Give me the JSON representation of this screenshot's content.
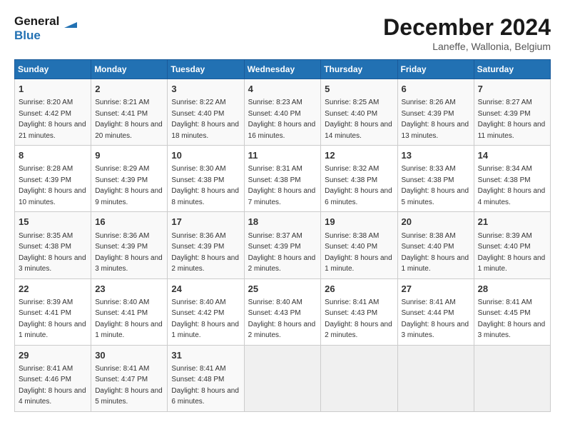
{
  "header": {
    "logo_line1": "General",
    "logo_line2": "Blue",
    "month_title": "December 2024",
    "location": "Laneffe, Wallonia, Belgium"
  },
  "days_of_week": [
    "Sunday",
    "Monday",
    "Tuesday",
    "Wednesday",
    "Thursday",
    "Friday",
    "Saturday"
  ],
  "weeks": [
    [
      {
        "day": "1",
        "sunrise": "8:20 AM",
        "sunset": "4:42 PM",
        "daylight": "8 hours and 21 minutes."
      },
      {
        "day": "2",
        "sunrise": "8:21 AM",
        "sunset": "4:41 PM",
        "daylight": "8 hours and 20 minutes."
      },
      {
        "day": "3",
        "sunrise": "8:22 AM",
        "sunset": "4:40 PM",
        "daylight": "8 hours and 18 minutes."
      },
      {
        "day": "4",
        "sunrise": "8:23 AM",
        "sunset": "4:40 PM",
        "daylight": "8 hours and 16 minutes."
      },
      {
        "day": "5",
        "sunrise": "8:25 AM",
        "sunset": "4:40 PM",
        "daylight": "8 hours and 14 minutes."
      },
      {
        "day": "6",
        "sunrise": "8:26 AM",
        "sunset": "4:39 PM",
        "daylight": "8 hours and 13 minutes."
      },
      {
        "day": "7",
        "sunrise": "8:27 AM",
        "sunset": "4:39 PM",
        "daylight": "8 hours and 11 minutes."
      }
    ],
    [
      {
        "day": "8",
        "sunrise": "8:28 AM",
        "sunset": "4:39 PM",
        "daylight": "8 hours and 10 minutes."
      },
      {
        "day": "9",
        "sunrise": "8:29 AM",
        "sunset": "4:39 PM",
        "daylight": "8 hours and 9 minutes."
      },
      {
        "day": "10",
        "sunrise": "8:30 AM",
        "sunset": "4:38 PM",
        "daylight": "8 hours and 8 minutes."
      },
      {
        "day": "11",
        "sunrise": "8:31 AM",
        "sunset": "4:38 PM",
        "daylight": "8 hours and 7 minutes."
      },
      {
        "day": "12",
        "sunrise": "8:32 AM",
        "sunset": "4:38 PM",
        "daylight": "8 hours and 6 minutes."
      },
      {
        "day": "13",
        "sunrise": "8:33 AM",
        "sunset": "4:38 PM",
        "daylight": "8 hours and 5 minutes."
      },
      {
        "day": "14",
        "sunrise": "8:34 AM",
        "sunset": "4:38 PM",
        "daylight": "8 hours and 4 minutes."
      }
    ],
    [
      {
        "day": "15",
        "sunrise": "8:35 AM",
        "sunset": "4:38 PM",
        "daylight": "8 hours and 3 minutes."
      },
      {
        "day": "16",
        "sunrise": "8:36 AM",
        "sunset": "4:39 PM",
        "daylight": "8 hours and 3 minutes."
      },
      {
        "day": "17",
        "sunrise": "8:36 AM",
        "sunset": "4:39 PM",
        "daylight": "8 hours and 2 minutes."
      },
      {
        "day": "18",
        "sunrise": "8:37 AM",
        "sunset": "4:39 PM",
        "daylight": "8 hours and 2 minutes."
      },
      {
        "day": "19",
        "sunrise": "8:38 AM",
        "sunset": "4:40 PM",
        "daylight": "8 hours and 1 minute."
      },
      {
        "day": "20",
        "sunrise": "8:38 AM",
        "sunset": "4:40 PM",
        "daylight": "8 hours and 1 minute."
      },
      {
        "day": "21",
        "sunrise": "8:39 AM",
        "sunset": "4:40 PM",
        "daylight": "8 hours and 1 minute."
      }
    ],
    [
      {
        "day": "22",
        "sunrise": "8:39 AM",
        "sunset": "4:41 PM",
        "daylight": "8 hours and 1 minute."
      },
      {
        "day": "23",
        "sunrise": "8:40 AM",
        "sunset": "4:41 PM",
        "daylight": "8 hours and 1 minute."
      },
      {
        "day": "24",
        "sunrise": "8:40 AM",
        "sunset": "4:42 PM",
        "daylight": "8 hours and 1 minute."
      },
      {
        "day": "25",
        "sunrise": "8:40 AM",
        "sunset": "4:43 PM",
        "daylight": "8 hours and 2 minutes."
      },
      {
        "day": "26",
        "sunrise": "8:41 AM",
        "sunset": "4:43 PM",
        "daylight": "8 hours and 2 minutes."
      },
      {
        "day": "27",
        "sunrise": "8:41 AM",
        "sunset": "4:44 PM",
        "daylight": "8 hours and 3 minutes."
      },
      {
        "day": "28",
        "sunrise": "8:41 AM",
        "sunset": "4:45 PM",
        "daylight": "8 hours and 3 minutes."
      }
    ],
    [
      {
        "day": "29",
        "sunrise": "8:41 AM",
        "sunset": "4:46 PM",
        "daylight": "8 hours and 4 minutes."
      },
      {
        "day": "30",
        "sunrise": "8:41 AM",
        "sunset": "4:47 PM",
        "daylight": "8 hours and 5 minutes."
      },
      {
        "day": "31",
        "sunrise": "8:41 AM",
        "sunset": "4:48 PM",
        "daylight": "8 hours and 6 minutes."
      },
      null,
      null,
      null,
      null
    ]
  ],
  "labels": {
    "sunrise": "Sunrise:",
    "sunset": "Sunset:",
    "daylight": "Daylight:"
  }
}
